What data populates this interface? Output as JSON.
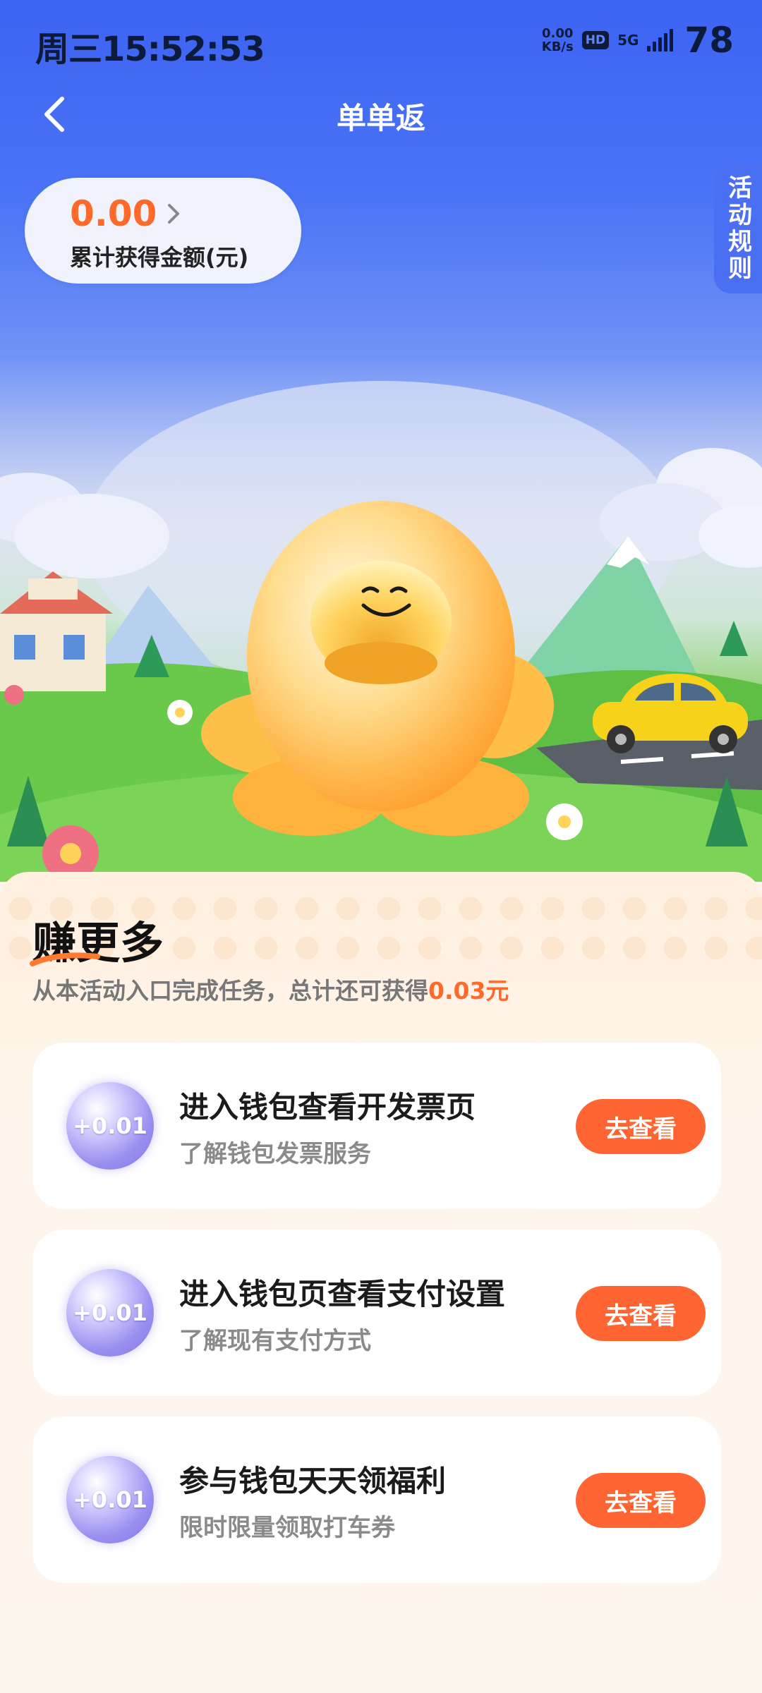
{
  "status_bar": {
    "time": "周三15:52:53",
    "net_speed_value": "0.00",
    "net_speed_unit": "KB/s",
    "hd": "HD",
    "network": "5G",
    "battery": "78"
  },
  "header": {
    "title": "单单返"
  },
  "earnings": {
    "amount": "0.00",
    "label": "累计获得金额(元)"
  },
  "rules_tab": "活动规则",
  "section": {
    "title": "赚更多",
    "desc_prefix": "从本活动入口完成任务，总计还可获得",
    "desc_amount": "0.03元"
  },
  "tasks": [
    {
      "reward": "+0.01",
      "title": "进入钱包查看开发票页",
      "subtitle": "了解钱包发票服务",
      "button": "去查看"
    },
    {
      "reward": "+0.01",
      "title": "进入钱包页查看支付设置",
      "subtitle": "了解现有支付方式",
      "button": "去查看"
    },
    {
      "reward": "+0.01",
      "title": "参与钱包天天领福利",
      "subtitle": "限时限量领取打车券",
      "button": "去查看"
    }
  ],
  "colors": {
    "accent": "#ff6433",
    "header_blue": "#3d63f3",
    "highlight_orange": "#ff6a2b"
  },
  "icons": [
    "back-arrow-icon",
    "chevron-right-icon",
    "signal-icon"
  ]
}
